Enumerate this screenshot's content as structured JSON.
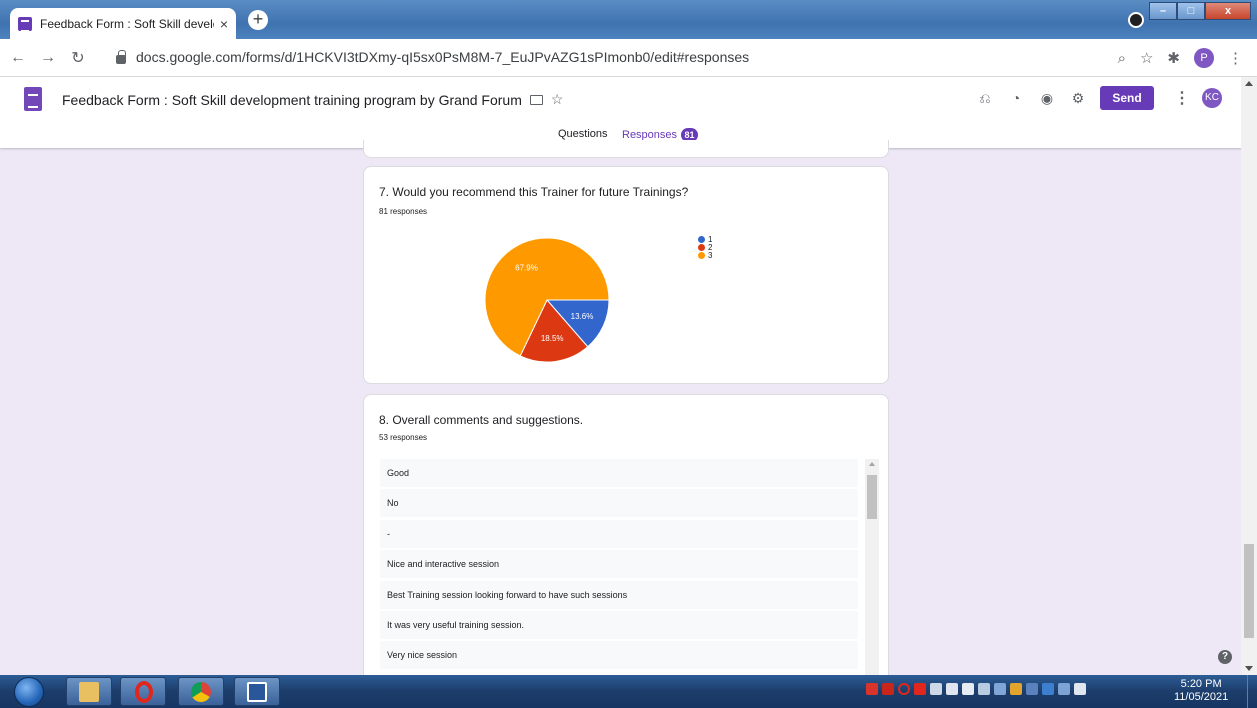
{
  "browser": {
    "tab_title": "Feedback Form : Soft Skill develo",
    "tab_close": "×",
    "new_tab": "+",
    "url": "docs.google.com/forms/d/1HCKVI3tDXmy-qI5sx0PsM8M-7_EuJPvAZG1sPImonb0/edit#responses",
    "profile_initial": "P",
    "window_controls": [
      "–",
      "□",
      "x"
    ]
  },
  "forms_header": {
    "title": "Feedback Form : Soft Skill development training program by Grand Forum",
    "send_label": "Send",
    "avatar_initials": "KC",
    "tabs": {
      "questions": "Questions",
      "responses": "Responses",
      "responses_count": "81"
    }
  },
  "question7": {
    "title": "7. Would you recommend this Trainer for future Trainings?",
    "responses": "81 responses",
    "chart_data": {
      "type": "pie",
      "categories": [
        "1",
        "2",
        "3"
      ],
      "values": [
        13.6,
        18.5,
        67.9
      ],
      "labels": [
        "13.6%",
        "18.5%",
        "67.9%"
      ],
      "colors": [
        "#3366cc",
        "#dc3912",
        "#ff9900"
      ],
      "legend_position": "right"
    }
  },
  "question8": {
    "title": "8. Overall comments and suggestions.",
    "responses": "53 responses",
    "answers": [
      "Good",
      "No",
      "-",
      "Nice and interactive session",
      "Best Training session looking forward to have such sessions",
      "It was very useful training session.",
      "Very nice session"
    ]
  },
  "taskbar": {
    "time": "5:20 PM",
    "date": "11/05/2021"
  },
  "colors": {
    "accent": "#673ab7",
    "background": "#ede7f6"
  }
}
